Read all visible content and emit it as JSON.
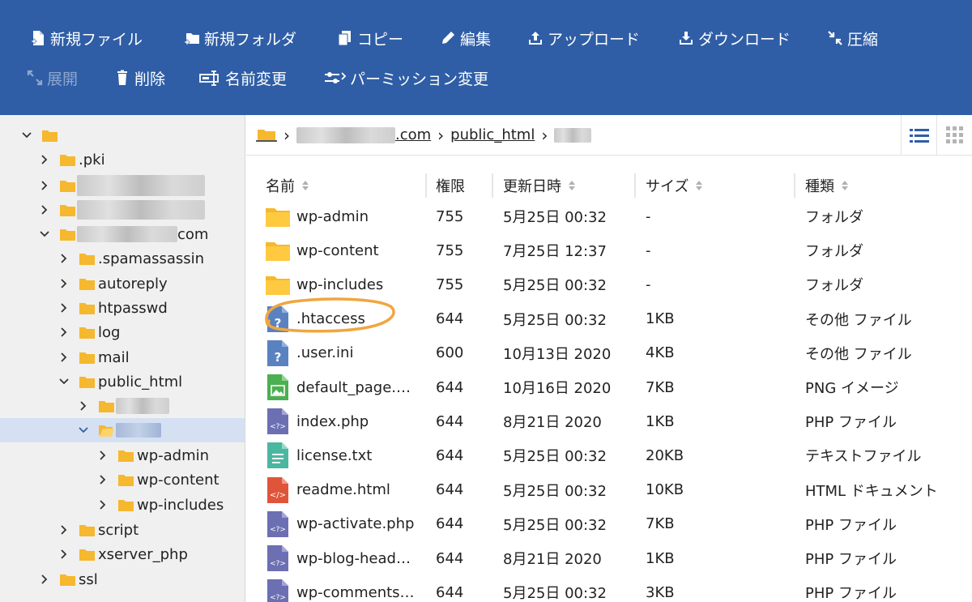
{
  "toolbar": {
    "new_file": "新規ファイル",
    "new_folder": "新規フォルダ",
    "copy": "コピー",
    "edit": "編集",
    "upload": "アップロード",
    "download": "ダウンロード",
    "compress": "圧縮",
    "extract": "展開",
    "delete": "削除",
    "rename": "名前変更",
    "permission": "パーミッション変更"
  },
  "sidebar": {
    "items": [
      {
        "label": ""
      },
      {
        "label": ".pki"
      },
      {
        "label": ""
      },
      {
        "label": ""
      },
      {
        "label": "com"
      },
      {
        "label": ".spamassassin"
      },
      {
        "label": "autoreply"
      },
      {
        "label": "htpasswd"
      },
      {
        "label": "log"
      },
      {
        "label": "mail"
      },
      {
        "label": "public_html"
      },
      {
        "label": ""
      },
      {
        "label": ""
      },
      {
        "label": "wp-admin"
      },
      {
        "label": "wp-content"
      },
      {
        "label": "wp-includes"
      },
      {
        "label": "script"
      },
      {
        "label": "xserver_php"
      },
      {
        "label": "ssl"
      }
    ]
  },
  "breadcrumb": {
    "domain_suffix": ".com",
    "public_html": "public_html"
  },
  "table": {
    "headers": {
      "name": "名前",
      "perm": "権限",
      "date": "更新日時",
      "size": "サイズ",
      "type": "種類"
    },
    "rows": [
      {
        "name": "wp-admin",
        "perm": "755",
        "date": "5月25日 00:32",
        "size": "-",
        "type": "フォルダ",
        "icon": "folder-icon"
      },
      {
        "name": "wp-content",
        "perm": "755",
        "date": "7月25日 12:37",
        "size": "-",
        "type": "フォルダ",
        "icon": "folder-icon"
      },
      {
        "name": "wp-includes",
        "perm": "755",
        "date": "5月25日 00:32",
        "size": "-",
        "type": "フォルダ",
        "icon": "folder-icon"
      },
      {
        "name": ".htaccess",
        "perm": "644",
        "date": "5月25日 00:32",
        "size": "1KB",
        "type": "その他 ファイル",
        "icon": "unknown-file-icon"
      },
      {
        "name": ".user.ini",
        "perm": "600",
        "date": "10月13日 2020",
        "size": "4KB",
        "type": "その他 ファイル",
        "icon": "unknown-file-icon"
      },
      {
        "name": "default_page.png",
        "perm": "644",
        "date": "10月16日 2020",
        "size": "7KB",
        "type": "PNG イメージ",
        "icon": "image-file-icon"
      },
      {
        "name": "index.php",
        "perm": "644",
        "date": "8月21日 2020",
        "size": "1KB",
        "type": "PHP ファイル",
        "icon": "php-file-icon"
      },
      {
        "name": "license.txt",
        "perm": "644",
        "date": "5月25日 00:32",
        "size": "20KB",
        "type": "テキストファイル",
        "icon": "text-file-icon"
      },
      {
        "name": "readme.html",
        "perm": "644",
        "date": "5月25日 00:32",
        "size": "10KB",
        "type": "HTML ドキュメント",
        "icon": "html-file-icon"
      },
      {
        "name": "wp-activate.php",
        "perm": "644",
        "date": "5月25日 00:32",
        "size": "7KB",
        "type": "PHP ファイル",
        "icon": "php-file-icon"
      },
      {
        "name": "wp-blog-heade…",
        "perm": "644",
        "date": "8月21日 2020",
        "size": "1KB",
        "type": "PHP ファイル",
        "icon": "php-file-icon"
      },
      {
        "name": "wp-comments-…",
        "perm": "644",
        "date": "5月25日 00:32",
        "size": "3KB",
        "type": "PHP ファイル",
        "icon": "php-file-icon"
      }
    ]
  },
  "colors": {
    "toolbar_bg": "#2f5ea6",
    "folder": "#f5b82e",
    "selected_row": "#d5e1f3",
    "annotation_ring": "#f0a640",
    "php_icon": "#6d6fb3",
    "text_icon": "#4bb7a0",
    "html_icon": "#e0553a",
    "image_icon": "#4caf50",
    "unknown_icon": "#5a82c1"
  }
}
